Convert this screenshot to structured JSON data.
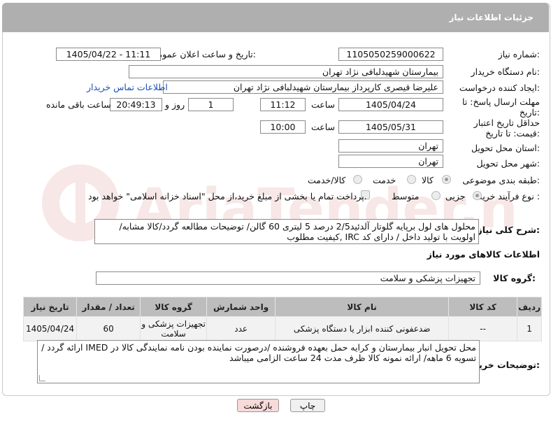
{
  "header": {
    "title": "جزئیات اطلاعات نیاز"
  },
  "fields": {
    "need_number_label": "شماره نیاز:",
    "need_number": "1105050259000622",
    "announce_label": "تاریخ و ساعت اعلان عمومی:",
    "announce_value": "1405/04/22 - 11:11",
    "buyer_org_label": "نام دستگاه خریدار:",
    "buyer_org": "بیمارستان شهیدلبافی نژاد تهران",
    "creator_label": "ایجاد کننده درخواست:",
    "creator": "علیرضا قیصری کارپرداز بیمارستان شهیدلبافی نژاد تهران",
    "contact_link": "اطلاعات تماس خریدار",
    "deadline_label": "مهلت ارسال پاسخ: تا تاریخ:",
    "deadline_date": "1405/04/24",
    "time_label": "ساعت",
    "deadline_time": "11:12",
    "days_value": "1",
    "days_label": "روز و",
    "remaining_time": "20:49:13",
    "remaining_label": "ساعت باقی مانده",
    "validity_label": "حداقل تاریخ اعتبار قیمت: تا تاریخ:",
    "validity_date": "1405/05/31",
    "validity_time": "10:00",
    "province_label": "استان محل تحویل:",
    "province": "تهران",
    "city_label": "شهر محل تحویل:",
    "city": "تهران",
    "category_label": "طبقه بندی موضوعی:",
    "category_options": [
      "کالا",
      "خدمت",
      "کالا/خدمت"
    ],
    "process_label": "نوع فرآیند خرید :",
    "process_options": [
      "جزیی",
      "متوسط"
    ],
    "payment_note": "پرداخت تمام یا بخشی از مبلغ خرید،از محل \"اسناد خزانه اسلامی\" خواهد بود."
  },
  "description": {
    "label": "شرح کلی نیاز:",
    "text": "محلول های لول برپایه گلوتار آلدئید2/5 درصد 5 لیتری 60 گالن/ توضیحات مطالعه گردد/کالا مشابه/ اولویت با تولید داخل / دارای کد IRC ,کیفیت مطلوب"
  },
  "goods_section": {
    "title": "اطلاعات کالاهای مورد نیاز",
    "group_label": "گروه کالا:",
    "group_value": "تجهیزات پزشکی و سلامت"
  },
  "table": {
    "headers": [
      "ردیف",
      "کد کالا",
      "نام کالا",
      "واحد شمارش",
      "گروه کالا",
      "تعداد / مقدار",
      "تاریخ نیاز"
    ],
    "rows": [
      [
        "1",
        "--",
        "ضدعفونی کننده ابزار یا دستگاه پزشکی",
        "عدد",
        "تجهیزات پزشکی و سلامت",
        "60",
        "1405/04/24"
      ]
    ]
  },
  "buyer_notes": {
    "label": "توضیحات خریدار:",
    "text": "محل تحویل انبار بیمارستان و کرایه حمل بعهده فروشنده /درصورت نماینده بودن نامه نمایندگی کالا در  IMED ارائه گردد / تسویه 6 ماهه/ ارائه نمونه کالا ظرف مدت  24 ساعت الزامی میباشد"
  },
  "buttons": {
    "print": "چاپ",
    "back": "بازگشت"
  },
  "colors": {
    "header_bg": "#afafaf",
    "table_header_bg": "#bdbdbd",
    "back_button_bg": "#f7dada",
    "link": "#1a4fb4"
  }
}
